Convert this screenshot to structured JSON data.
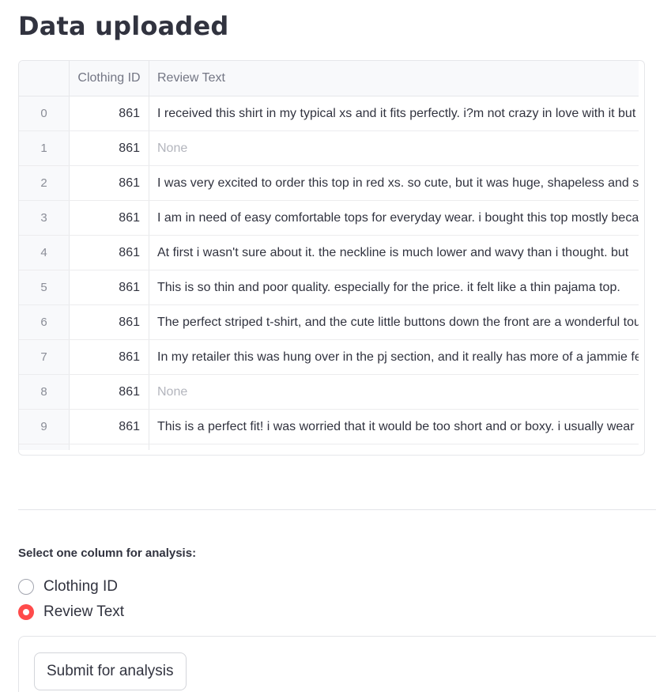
{
  "page": {
    "title": "Data uploaded"
  },
  "table": {
    "columns": [
      "Clothing ID",
      "Review Text"
    ],
    "rows": [
      {
        "index": "0",
        "clothing_id": "861",
        "review_text": "I received this shirt in my typical xs and it fits perfectly. i?m not crazy in love with it but it's a nice shirt",
        "is_none": false
      },
      {
        "index": "1",
        "clothing_id": "861",
        "review_text": "None",
        "is_none": true
      },
      {
        "index": "2",
        "clothing_id": "861",
        "review_text": "I was very excited to order this top in red xs. so cute, but it was huge, shapeless and support thin",
        "is_none": false
      },
      {
        "index": "3",
        "clothing_id": "861",
        "review_text": "I am in need of easy comfortable tops for everyday wear. i bought this top mostly because",
        "is_none": false
      },
      {
        "index": "4",
        "clothing_id": "861",
        "review_text": "At first i wasn't sure about it. the neckline is much lower and wavy than i thought. but",
        "is_none": false
      },
      {
        "index": "5",
        "clothing_id": "861",
        "review_text": "This is so thin and poor quality. especially for the price. it felt like a thin pajama top.",
        "is_none": false
      },
      {
        "index": "6",
        "clothing_id": "861",
        "review_text": "The perfect striped t-shirt, and the cute little buttons down the front are a wonderful touch",
        "is_none": false
      },
      {
        "index": "7",
        "clothing_id": "861",
        "review_text": "In my retailer this was hung over in the pj section, and it really has more of a jammie feel",
        "is_none": false
      },
      {
        "index": "8",
        "clothing_id": "861",
        "review_text": "None",
        "is_none": true
      },
      {
        "index": "9",
        "clothing_id": "861",
        "review_text": "This is a perfect fit! i was worried that it would be too short and or boxy. i usually  wear",
        "is_none": false
      }
    ]
  },
  "analysis": {
    "label": "Select one column for analysis:",
    "options": [
      {
        "label": "Clothing ID",
        "checked": false
      },
      {
        "label": "Review Text",
        "checked": true
      }
    ],
    "submit_label": "Submit for analysis"
  },
  "colors": {
    "accent": "#ff4b4b",
    "text": "#31333f",
    "muted": "#8a8d97",
    "none_text": "#b3b5bd",
    "header_bg": "#f8f9fb",
    "border": "#e6e7ea"
  }
}
